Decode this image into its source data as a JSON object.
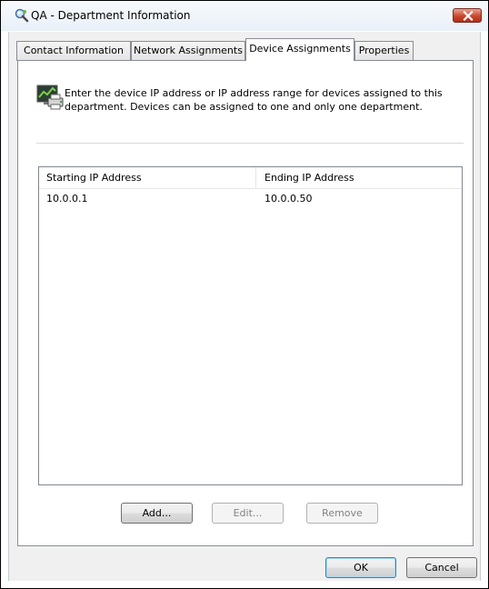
{
  "window": {
    "title": "QA - Department Information"
  },
  "tabs": [
    {
      "label": "Contact Information",
      "active": false
    },
    {
      "label": "Network Assignments",
      "active": false
    },
    {
      "label": "Device Assignments",
      "active": true
    },
    {
      "label": "Properties",
      "active": false
    }
  ],
  "panel": {
    "description": "Enter the device IP address or IP address range for devices assigned to this department.  Devices can be assigned to one and only one department.",
    "icon": "device-monitor-icon"
  },
  "list": {
    "columns": [
      "Starting IP Address",
      "Ending IP Address"
    ],
    "rows": [
      [
        "10.0.0.1",
        "10.0.0.50"
      ]
    ]
  },
  "list_buttons": {
    "add": "Add...",
    "edit": "Edit...",
    "remove": "Remove"
  },
  "dialog_buttons": {
    "ok": "OK",
    "cancel": "Cancel"
  },
  "colors": {
    "close_button": "#c8482f",
    "tab_border": "#898c95",
    "default_button_border": "#3c7fb1"
  }
}
